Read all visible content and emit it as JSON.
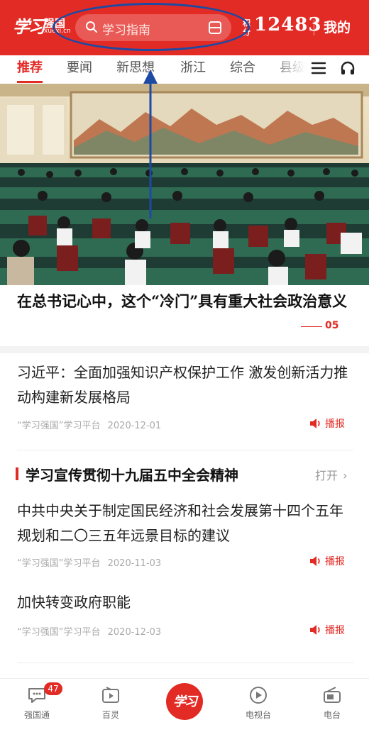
{
  "header": {
    "logo_main": "学习",
    "logo_side": "强国",
    "logo_url": "xuexi.cn",
    "search_placeholder": "学习指南",
    "score_label": "积分",
    "score": "12483",
    "mine_label": "我的"
  },
  "tabs": [
    {
      "label": "推荐",
      "active": true
    },
    {
      "label": "要闻"
    },
    {
      "label": "新思想"
    },
    {
      "label": "浙江"
    },
    {
      "label": "综合"
    },
    {
      "label": "县级"
    }
  ],
  "hero": {
    "title": "在总书记心中，这个“冷门”具有重大社会政治意义",
    "page": "05"
  },
  "articles": [
    {
      "title": "习近平：全面加强知识产权保护工作 激发创新活力推动构建新发展格局",
      "source": "“学习强国”学习平台",
      "date": "2020-12-01",
      "play": "播报"
    }
  ],
  "section": {
    "title": "学习宣传贯彻十九届五中全会精神",
    "open": "打开",
    "items": [
      {
        "title": "中共中央关于制定国民经济和社会发展第十四个五年规划和二〇三五年远景目标的建议",
        "source": "“学习强国”学习平台",
        "date": "2020-11-03",
        "play": "播报"
      },
      {
        "title": "加快转变政府职能",
        "source": "“学习强国”学习平台",
        "date": "2020-12-03",
        "play": "播报"
      }
    ]
  },
  "bottom_nav": {
    "items": [
      {
        "label": "强国通",
        "icon": "chat-icon",
        "badge": "47"
      },
      {
        "label": "百灵",
        "icon": "play-box-icon"
      },
      {
        "label": "学习",
        "icon": "xuexi-logo"
      },
      {
        "label": "电视台",
        "icon": "play-circle-icon"
      },
      {
        "label": "电台",
        "icon": "radio-icon"
      }
    ]
  },
  "colors": {
    "brand_red": "#e32b26",
    "annotation_blue": "#1d4aa3"
  }
}
